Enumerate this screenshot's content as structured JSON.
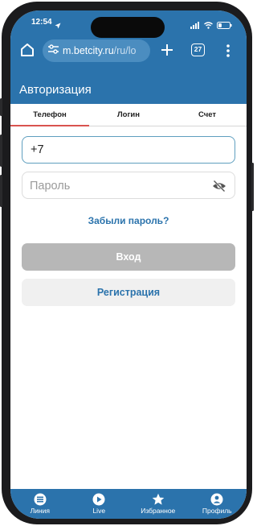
{
  "status_bar": {
    "time": "12:54",
    "battery_level": 0.3
  },
  "browser": {
    "url_host": "m.betcity.ru",
    "url_path": "/ru/lo",
    "tab_count": "27",
    "icons": {
      "home": "home-icon",
      "site_settings": "tune-icon",
      "new_tab": "plus-icon",
      "menu": "kebab-menu-icon"
    }
  },
  "header": {
    "title": "Авторизация"
  },
  "login_tabs": [
    {
      "label": "Телефон",
      "active": true
    },
    {
      "label": "Логин",
      "active": false
    },
    {
      "label": "Счет",
      "active": false
    }
  ],
  "form": {
    "phone_value": "+7",
    "password_placeholder": "Пароль",
    "forgot_password": "Забыли пароль?",
    "login_button": "Вход",
    "register_button": "Регистрация"
  },
  "bottom_nav": [
    {
      "label": "Линия",
      "icon": "line-icon"
    },
    {
      "label": "Live",
      "icon": "live-play-icon"
    },
    {
      "label": "Избранное",
      "icon": "star-icon"
    },
    {
      "label": "Профиль",
      "icon": "profile-icon"
    }
  ],
  "colors": {
    "brand": "#2b73ac",
    "tab_indicator": "#d9534f",
    "disabled_button": "#b7b7b7"
  }
}
